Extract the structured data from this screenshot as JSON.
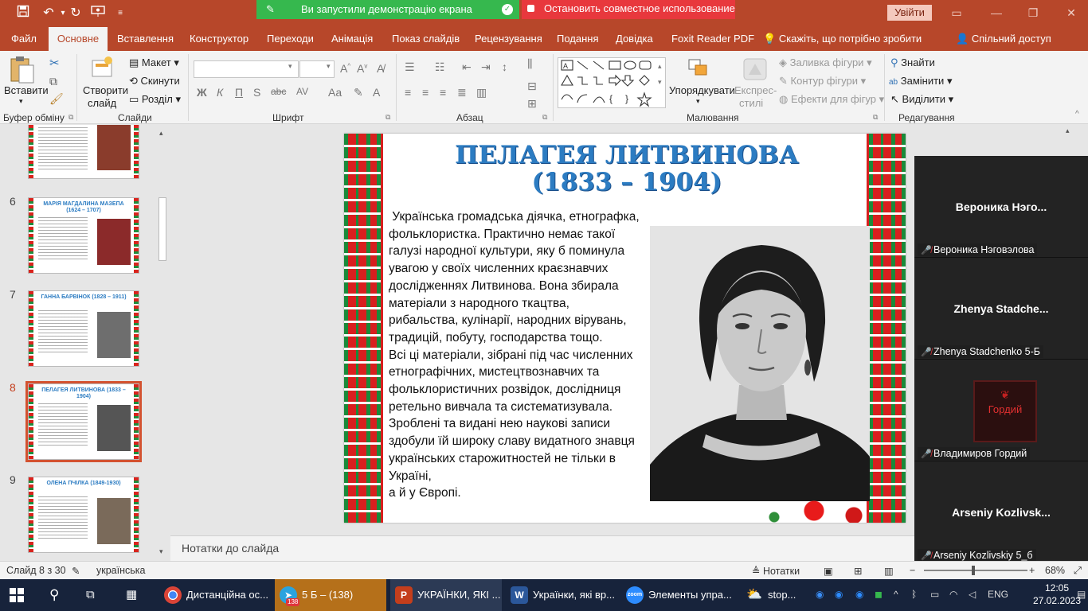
{
  "titlebar": {
    "share_active": "Ви запустили демонстрацію екрана",
    "stop_share": "Остановить совместное использование",
    "sign_in": "Увійти"
  },
  "tabs": [
    "Файл",
    "Основне",
    "Вставлення",
    "Конструктор",
    "Переходи",
    "Анімація",
    "Показ слайдів",
    "Рецензування",
    "Подання",
    "Довідка",
    "Foxit Reader PDF"
  ],
  "tell_me": "Скажіть, що потрібно зробити",
  "shared_access": "Спільний доступ",
  "ribbon": {
    "paste": "Вставити",
    "new_slide": [
      "Створити",
      "слайд"
    ],
    "layout": "Макет",
    "reset": "Скинути",
    "section": "Розділ",
    "arrange": "Упорядкувати",
    "quick_styles": [
      "Експрес-",
      "стилі"
    ],
    "shape_fill": "Заливка фігури",
    "shape_outline": "Контур фігури",
    "shape_effects": "Ефекти для фігур",
    "find": "Знайти",
    "replace": "Замінити",
    "select": "Виділити",
    "groups": {
      "clipboard": "Буфер обміну",
      "slides": "Слайди",
      "font": "Шрифт",
      "paragraph": "Абзац",
      "drawing": "Малювання",
      "editing": "Редагування"
    },
    "font_buttons": [
      "Ж",
      "К",
      "П",
      "S",
      "abc"
    ]
  },
  "thumbnails": [
    {
      "num": "",
      "title": ""
    },
    {
      "num": "6",
      "title": "МАРІЯ МАГДАЛИНА МАЗЕПА (1624 – 1707)"
    },
    {
      "num": "7",
      "title": "ГАННА БАРВІНОК (1828 – 1911)"
    },
    {
      "num": "8",
      "title": "ПЕЛАГЕЯ ЛИТВИНОВА (1833 – 1904)"
    },
    {
      "num": "9",
      "title": "ОЛЕНА ПЧІЛКА (1849-1930)"
    }
  ],
  "slide": {
    "title_line1": "ПЕЛАГЕЯ ЛИТВИНОВА",
    "title_line2": "(1833 – 1904)",
    "body": [
      " Українська громадська діячка, етнографка,",
      "фольклористка. Практично немає такої",
      "галузі народної культури, яку б поминула",
      "увагою у своїх численних краєзнавчих",
      "дослідженнях Литвинова. Вона збирала",
      "матеріали з народного ткацтва,",
      "рибальства, кулінарії, народних вірувань,",
      "традицій, побуту, господарства тощо.",
      "Всі ці матеріали, зібрані під час численних",
      "етнографічних, мистецтвознавчих та",
      "фольклористичних розвідок, дослідниця",
      "ретельно вивчала та систематизувала.",
      "Зроблені та видані нею наукові записи",
      "здобули їй широку славу видатного знавця",
      "українських старожитностей не тільки в",
      "Україні,",
      "а й у Європі."
    ]
  },
  "notes_placeholder": "Нотатки до слайда",
  "participants": [
    {
      "big": "Вероника  Нэго...",
      "label": "Вероника Нэговэлова"
    },
    {
      "big": "Zhenya  Stadche...",
      "label": "Zhenya Stadchenko 5-Б"
    },
    {
      "big": "Гордий",
      "label": "Владимиров Гордий"
    },
    {
      "big": "Arseniy  Kozlivsk...",
      "label": "Arseniy Kozlivskiy 5_б"
    }
  ],
  "status": {
    "slide_info": "Слайд 8 з 30",
    "language": "українська",
    "notes": "Нотатки",
    "zoom": "68%"
  },
  "taskbar": {
    "apps": [
      {
        "label": "Дистанційна ос...",
        "icon": "chrome-icon"
      },
      {
        "label": "5 Б – (138)",
        "icon": "telegram-icon",
        "badge": "138"
      },
      {
        "label": "УКРАЇНКИ, ЯКІ ...",
        "icon": "powerpoint-icon"
      },
      {
        "label": "Українки, які вр...",
        "icon": "word-icon"
      },
      {
        "label": "Элементы упра...",
        "icon": "zoom-icon"
      },
      {
        "label": "stop...",
        "icon": "weather-icon"
      }
    ],
    "lang": "ENG",
    "time": "12:05",
    "date": "27.02.2023"
  },
  "colors": {
    "accent": "#b7472a",
    "title_blue": "#2c7cc2",
    "green_banner": "#36b84e",
    "red_banner": "#e8383d",
    "taskbar": "#17233b"
  }
}
